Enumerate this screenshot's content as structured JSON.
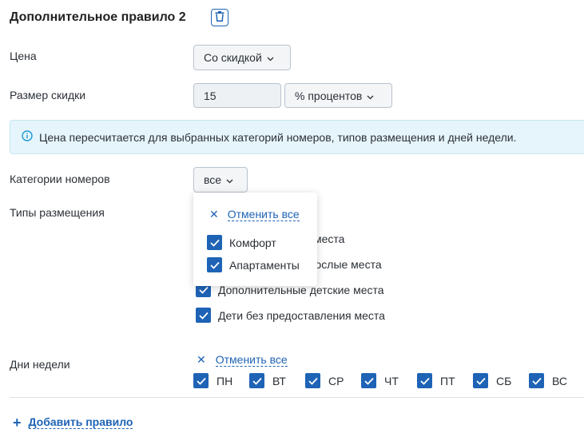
{
  "rule": {
    "title": "Дополнительное правило 2"
  },
  "price": {
    "label": "Цена",
    "value": "Со скидкой"
  },
  "discount": {
    "label": "Размер скидки",
    "amount": "15",
    "unit": "% процентов"
  },
  "info": {
    "text": "Цена пересчитается для выбранных категорий номеров, типов размещения и дней недели."
  },
  "room_categories": {
    "label": "Категории номеров",
    "value": "все",
    "dropdown": {
      "clear_all": "Отменить все",
      "options": [
        {
          "label": "Комфорт",
          "checked": true
        },
        {
          "label": "Апартаменты",
          "checked": true
        }
      ]
    }
  },
  "accommodation": {
    "label": "Типы размещения",
    "items": [
      {
        "label": "места",
        "checked": true
      },
      {
        "label": "взрослые места",
        "checked": true
      },
      {
        "label": "Дополнительные детские места",
        "checked": true
      },
      {
        "label": "Дети без предоставления места",
        "checked": true
      }
    ]
  },
  "weekdays": {
    "label": "Дни недели",
    "clear_all": "Отменить все",
    "days": [
      {
        "label": "ПН",
        "checked": true
      },
      {
        "label": "ВТ",
        "checked": true
      },
      {
        "label": "СР",
        "checked": true
      },
      {
        "label": "ЧТ",
        "checked": true
      },
      {
        "label": "ПТ",
        "checked": true
      },
      {
        "label": "СБ",
        "checked": true
      },
      {
        "label": "ВС",
        "checked": true
      }
    ]
  },
  "add_rule": {
    "label": "Добавить правило"
  },
  "colors": {
    "accent": "#1e63b5",
    "info_bg": "#e6f5fb",
    "info_icon": "#1a9bd7"
  }
}
